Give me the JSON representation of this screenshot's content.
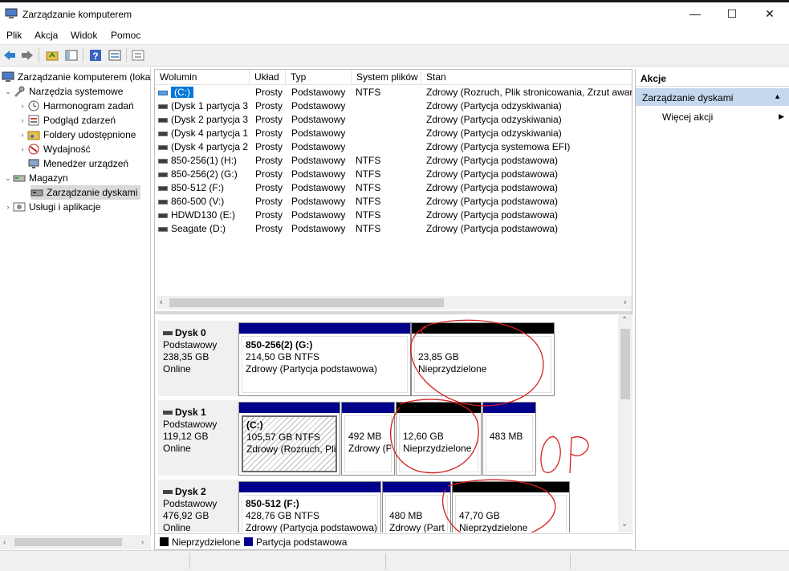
{
  "window": {
    "title": "Zarządzanie komputerem",
    "minimize": "—",
    "maximize": "☐",
    "close": "✕"
  },
  "menu": [
    "Plik",
    "Akcja",
    "Widok",
    "Pomoc"
  ],
  "tree": {
    "root": "Zarządzanie komputerem (loka",
    "system_tools": "Narzędzia systemowe",
    "task_scheduler": "Harmonogram zadań",
    "event_viewer": "Podgląd zdarzeń",
    "shared_folders": "Foldery udostępnione",
    "performance": "Wydajność",
    "device_manager": "Menedżer urządzeń",
    "storage": "Magazyn",
    "disk_management": "Zarządzanie dyskami",
    "services": "Usługi i aplikacje"
  },
  "volume_table": {
    "columns": [
      "Wolumin",
      "Układ",
      "Typ",
      "System plików",
      "Stan"
    ],
    "rows": [
      [
        "(C:)",
        "Prosty",
        "Podstawowy",
        "NTFS",
        "Zdrowy (Rozruch, Plik stronicowania, Zrzut awary"
      ],
      [
        "(Dysk 1 partycja 3)",
        "Prosty",
        "Podstawowy",
        "",
        "Zdrowy (Partycja odzyskiwania)"
      ],
      [
        "(Dysk 2 partycja 3)",
        "Prosty",
        "Podstawowy",
        "",
        "Zdrowy (Partycja odzyskiwania)"
      ],
      [
        "(Dysk 4 partycja 1)",
        "Prosty",
        "Podstawowy",
        "",
        "Zdrowy (Partycja odzyskiwania)"
      ],
      [
        "(Dysk 4 partycja 2)",
        "Prosty",
        "Podstawowy",
        "",
        "Zdrowy (Partycja systemowa EFI)"
      ],
      [
        "850-256(1) (H:)",
        "Prosty",
        "Podstawowy",
        "NTFS",
        "Zdrowy (Partycja podstawowa)"
      ],
      [
        "850-256(2) (G:)",
        "Prosty",
        "Podstawowy",
        "NTFS",
        "Zdrowy (Partycja podstawowa)"
      ],
      [
        "850-512 (F:)",
        "Prosty",
        "Podstawowy",
        "NTFS",
        "Zdrowy (Partycja podstawowa)"
      ],
      [
        "860-500 (V:)",
        "Prosty",
        "Podstawowy",
        "NTFS",
        "Zdrowy (Partycja podstawowa)"
      ],
      [
        "HDWD130 (E:)",
        "Prosty",
        "Podstawowy",
        "NTFS",
        "Zdrowy (Partycja podstawowa)"
      ],
      [
        "Seagate (D:)",
        "Prosty",
        "Podstawowy",
        "NTFS",
        "Zdrowy (Partycja podstawowa)"
      ]
    ]
  },
  "disks": [
    {
      "name": "Dysk 0",
      "type": "Podstawowy",
      "size": "238,35 GB",
      "status": "Online",
      "partitions": [
        {
          "title": "850-256(2)  (G:)",
          "line2": "214,50 GB NTFS",
          "line3": "Zdrowy (Partycja podstawowa)",
          "kind": "primary"
        },
        {
          "title": "",
          "line2": "23,85 GB",
          "line3": "Nieprzydzielone",
          "kind": "unallocated"
        }
      ]
    },
    {
      "name": "Dysk 1",
      "type": "Podstawowy",
      "size": "119,12 GB",
      "status": "Online",
      "partitions": [
        {
          "title": "(C:)",
          "line2": "105,57 GB NTFS",
          "line3": "Zdrowy (Rozruch, Plik",
          "kind": "primary-selected"
        },
        {
          "title": "",
          "line2": "492 MB",
          "line3": "Zdrowy (P",
          "kind": "primary"
        },
        {
          "title": "",
          "line2": "12,60 GB",
          "line3": "Nieprzydzielone",
          "kind": "unallocated"
        },
        {
          "title": "",
          "line2": "483 MB",
          "line3": "",
          "kind": "primary"
        }
      ]
    },
    {
      "name": "Dysk 2",
      "type": "Podstawowy",
      "size": "476,92 GB",
      "status": "Online",
      "partitions": [
        {
          "title": "850-512  (F:)",
          "line2": "428,76 GB NTFS",
          "line3": "Zdrowy (Partycja podstawowa)",
          "kind": "primary"
        },
        {
          "title": "",
          "line2": "480 MB",
          "line3": "Zdrowy (Part",
          "kind": "primary"
        },
        {
          "title": "",
          "line2": "47,70 GB",
          "line3": "Nieprzydzielone",
          "kind": "unallocated"
        }
      ]
    }
  ],
  "legend": {
    "unallocated": "Nieprzydzielone",
    "primary": "Partycja podstawowa"
  },
  "actions": {
    "header": "Akcje",
    "section": "Zarządzanie dyskami",
    "more": "Więcej akcji"
  },
  "colors": {
    "primary_bar": "#00008b",
    "unallocated_bar": "#000000",
    "annotation": "#d42020",
    "action_section_bg": "#c6d8ee"
  }
}
